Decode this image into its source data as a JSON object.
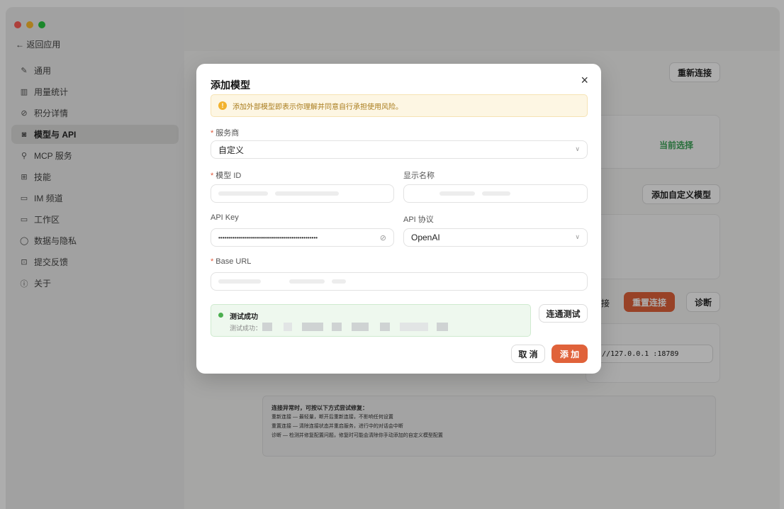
{
  "window": {
    "traffic_colors": [
      "#ff5f57",
      "#febc2e",
      "#28c840"
    ]
  },
  "sidebar": {
    "back_label": "← 返回应用",
    "items": [
      {
        "icon": "pencil-icon",
        "glyph": "✎",
        "label": "通用"
      },
      {
        "icon": "bar-chart-icon",
        "glyph": "▥",
        "label": "用量统计"
      },
      {
        "icon": "link-icon",
        "glyph": "⊘",
        "label": "积分详情"
      },
      {
        "icon": "model-icon",
        "glyph": "◙",
        "label": "模型与 API",
        "active": true
      },
      {
        "icon": "plug-icon",
        "glyph": "⚲",
        "label": "MCP 服务"
      },
      {
        "icon": "book-icon",
        "glyph": "⊞",
        "label": "技能"
      },
      {
        "icon": "chat-icon",
        "glyph": "▭",
        "label": "IM 频道"
      },
      {
        "icon": "folder-icon",
        "glyph": "▭",
        "label": "工作区"
      },
      {
        "icon": "shield-icon",
        "glyph": "◯",
        "label": "数据与隐私"
      },
      {
        "icon": "feedback-icon",
        "glyph": "⊡",
        "label": "提交反馈"
      },
      {
        "icon": "info-icon",
        "glyph": "ⓘ",
        "label": "关于"
      }
    ]
  },
  "background": {
    "reconnect_label": "重新连接",
    "current_selection": "当前选择",
    "add_custom_model": "添加自定义模型",
    "partial_label": "接",
    "reset_connection": "重置连接",
    "diagnose": "诊断",
    "ws_address": "ws://127.0.0.1 :18789",
    "help": {
      "title": "连接异常时，可按以下方式尝试修复：",
      "lines": [
        "重新连接 — 最轻量，断开后重新连接，不影响任何设置",
        "重置连接 — 清除连接状态并重启服务，进行中的对话会中断",
        "诊断 — 检测并修复配置问题，修复时可能会清除你手动添加的自定义模型配置"
      ]
    }
  },
  "modal": {
    "title": "添加模型",
    "close_glyph": "×",
    "warning": "添加外部模型即表示你理解并同意自行承担使用风险。",
    "provider": {
      "label": "服务商",
      "value": "自定义"
    },
    "model_id": {
      "label": "模型 ID",
      "value": ""
    },
    "display_name": {
      "label": "显示名称",
      "value": ""
    },
    "api_key": {
      "label": "API Key",
      "value": "••••••••••••••••••••••••••••••••••••••••••••••••••"
    },
    "api_protocol": {
      "label": "API 协议",
      "value": "OpenAI"
    },
    "base_url": {
      "label": "Base URL",
      "value": ""
    },
    "test": {
      "status": "测试成功",
      "detail": "测试成功："
    },
    "test_button": "连通测试",
    "cancel_button": "取 消",
    "add_button": "添 加",
    "accent": "#e0623a"
  }
}
